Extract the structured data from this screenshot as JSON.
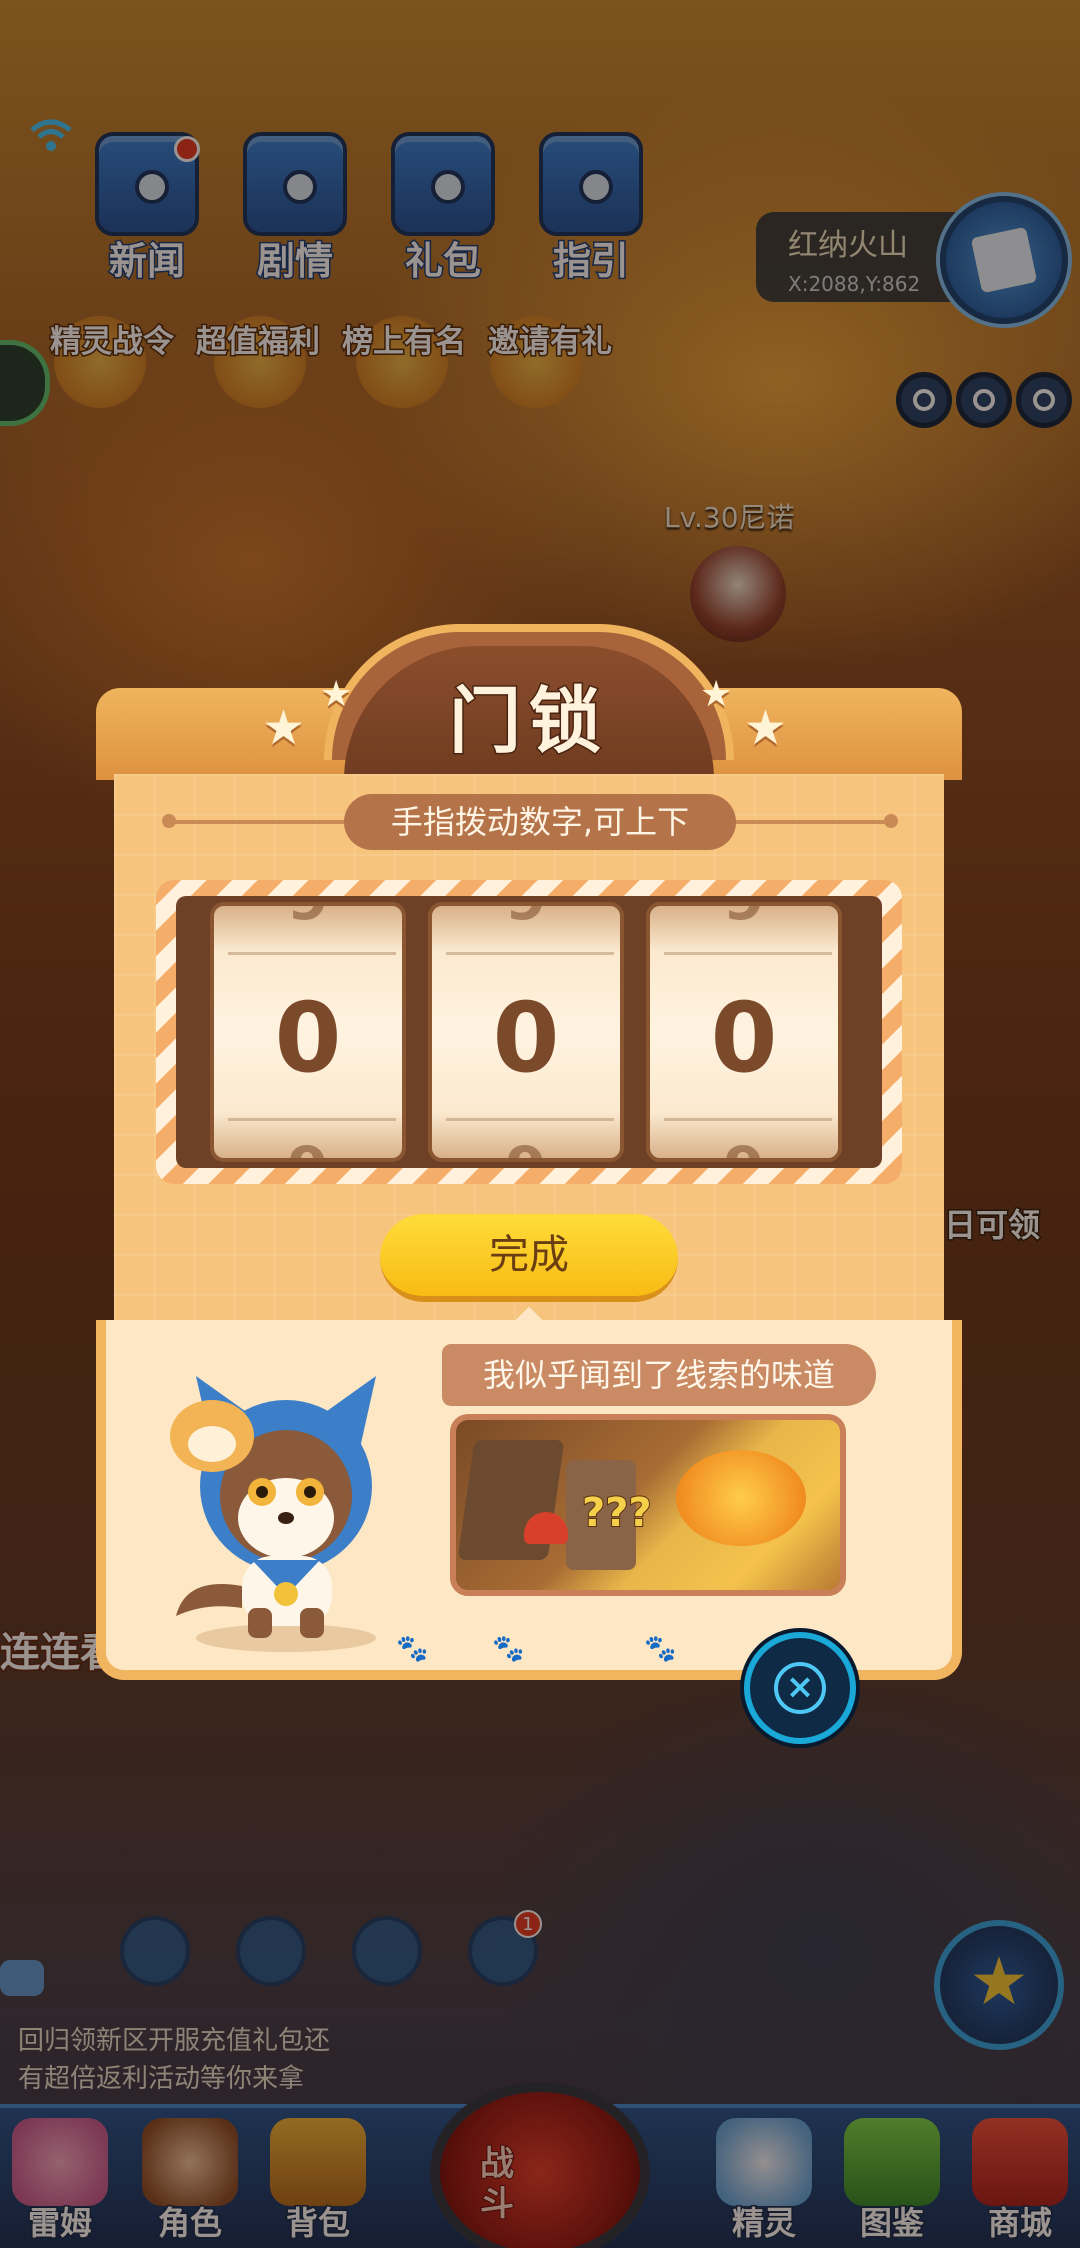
{
  "top_nav": [
    {
      "label": "新闻",
      "badge": true
    },
    {
      "label": "剧情",
      "badge": false
    },
    {
      "label": "礼包",
      "badge": false
    },
    {
      "label": "指引",
      "badge": false
    }
  ],
  "location": {
    "name": "红纳火山",
    "coords": "X:2088,Y:862"
  },
  "events": [
    "精灵战令",
    "超值福利",
    "榜上有名",
    "邀请有礼"
  ],
  "npc": {
    "level_name": "Lv.30尼诺"
  },
  "side_labels": {
    "right_claim": "日可领",
    "left_banner": "连连看"
  },
  "dialog": {
    "title": "门锁",
    "hint": "手指拨动数字,可上下",
    "dials": [
      {
        "value": "0",
        "peek": "9"
      },
      {
        "value": "0",
        "peek": "9"
      },
      {
        "value": "0",
        "peek": "9"
      }
    ],
    "done_label": "完成",
    "clue_text": "我似乎闻到了线索的味道",
    "clue_marks": "???",
    "close_symbol": "×"
  },
  "quick_actions": [
    {
      "icon": "map-quick-icon",
      "badge": ""
    },
    {
      "icon": "compass-quick-icon",
      "badge": ""
    },
    {
      "icon": "pet-quick-icon",
      "badge": ""
    },
    {
      "icon": "bell-quick-icon",
      "badge": "1"
    }
  ],
  "chat": {
    "line1": "回归领新区开服充值礼包还",
    "line2": "有超倍返利活动等你来拿"
  },
  "bottom_nav": [
    {
      "label": "雷姆",
      "icon": "leimu-icon"
    },
    {
      "label": "角色",
      "icon": "character-icon"
    },
    {
      "label": "背包",
      "icon": "backpack-icon"
    },
    {
      "label": "精灵",
      "icon": "spirit-icon"
    },
    {
      "label": "图鉴",
      "icon": "codex-icon"
    },
    {
      "label": "商城",
      "icon": "shop-icon"
    }
  ],
  "battle": {
    "label": "战斗"
  },
  "colors": {
    "dialog_header": "#a9633a",
    "done_button": "#fcc623",
    "close_accent": "#4cc8f2",
    "nav_bar": "#1f4f8e"
  }
}
